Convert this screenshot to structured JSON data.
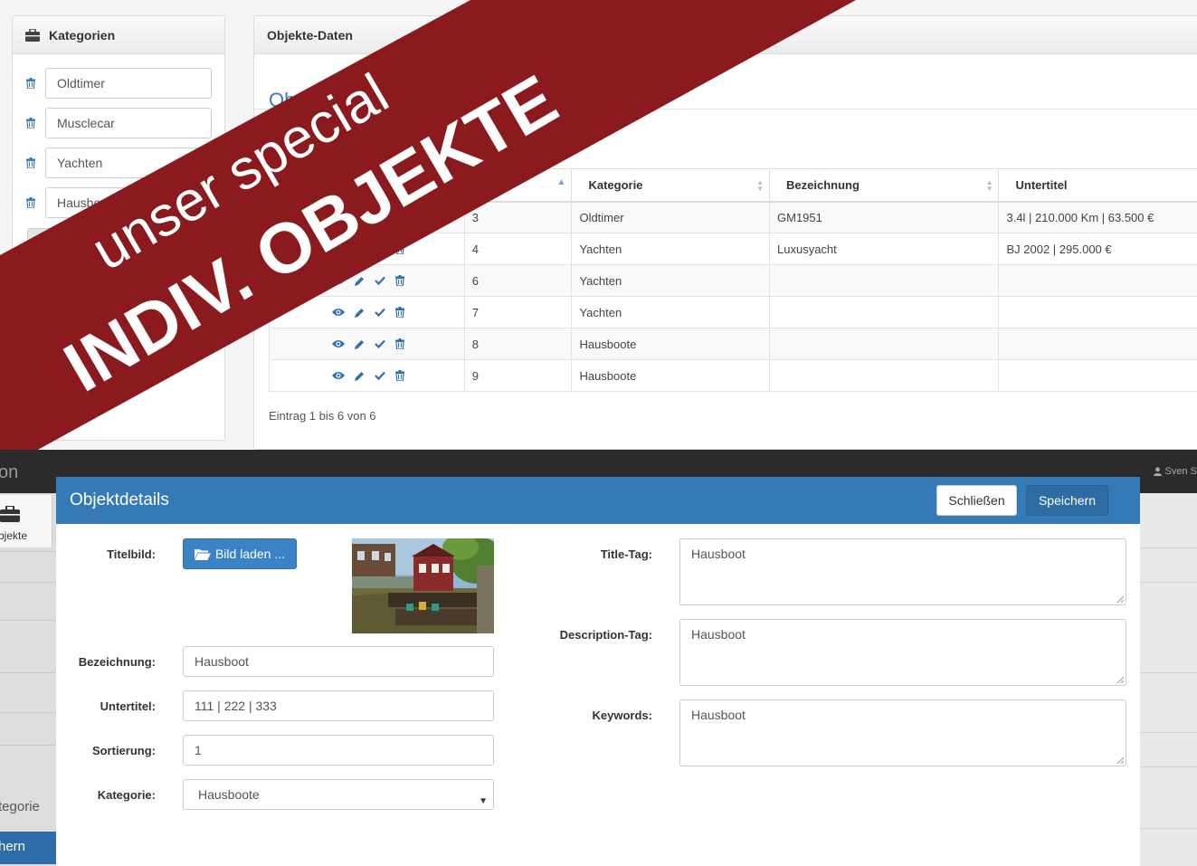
{
  "categories_panel": {
    "title": "Kategorien",
    "items": [
      "Oldtimer",
      "Musclecar",
      "Yachten",
      "Hausboote"
    ]
  },
  "objects_panel": {
    "title": "Objekte-Daten",
    "subtitle": "Ob",
    "columns": [
      "Kategorie",
      "Bezeichnung",
      "Untertitel"
    ],
    "rows": [
      {
        "id": "3",
        "kategorie": "Oldtimer",
        "bezeichnung": "GM1951",
        "untertitel": "3.4l | 210.000 Km | 63.500 €"
      },
      {
        "id": "4",
        "kategorie": "Yachten",
        "bezeichnung": "Luxusyacht",
        "untertitel": "BJ 2002 | 295.000 €"
      },
      {
        "id": "6",
        "kategorie": "Yachten",
        "bezeichnung": "",
        "untertitel": ""
      },
      {
        "id": "7",
        "kategorie": "Yachten",
        "bezeichnung": "",
        "untertitel": ""
      },
      {
        "id": "8",
        "kategorie": "Hausboote",
        "bezeichnung": "",
        "untertitel": ""
      },
      {
        "id": "9",
        "kategorie": "Hausboote",
        "bezeichnung": "",
        "untertitel": ""
      }
    ],
    "footer": "Eintrag 1 bis 6 von 6"
  },
  "banner": {
    "line1": "unser special",
    "line2": "INDIV. OBJEKTE",
    "color": "#8b1a1f"
  },
  "background_app": {
    "nav_fragment": "on",
    "user_fragment": "Sven S",
    "sidebar_label": "bjekte",
    "sidebar_kategorie": "tegorie",
    "sidebar_button": "hern"
  },
  "modal": {
    "title": "Objektdetails",
    "close_label": "Schließen",
    "save_label": "Speichern",
    "labels": {
      "titelbild": "Titelbild:",
      "bezeichnung": "Bezeichnung:",
      "untertitel": "Untertitel:",
      "sortierung": "Sortierung:",
      "kategorie": "Kategorie:",
      "title_tag": "Title-Tag:",
      "description_tag": "Description-Tag:",
      "keywords": "Keywords:"
    },
    "load_image_label": "Bild laden ...",
    "values": {
      "bezeichnung": "Hausboot",
      "untertitel": "111 | 222 | 333",
      "sortierung": "1",
      "kategorie": "Hausboote",
      "title_tag": "Hausboot",
      "description_tag": "Hausboot",
      "keywords": "Hausboot"
    }
  },
  "colors": {
    "primary": "#337ab7",
    "banner": "#8b1a1f",
    "link_blue": "#3a7bbf"
  }
}
